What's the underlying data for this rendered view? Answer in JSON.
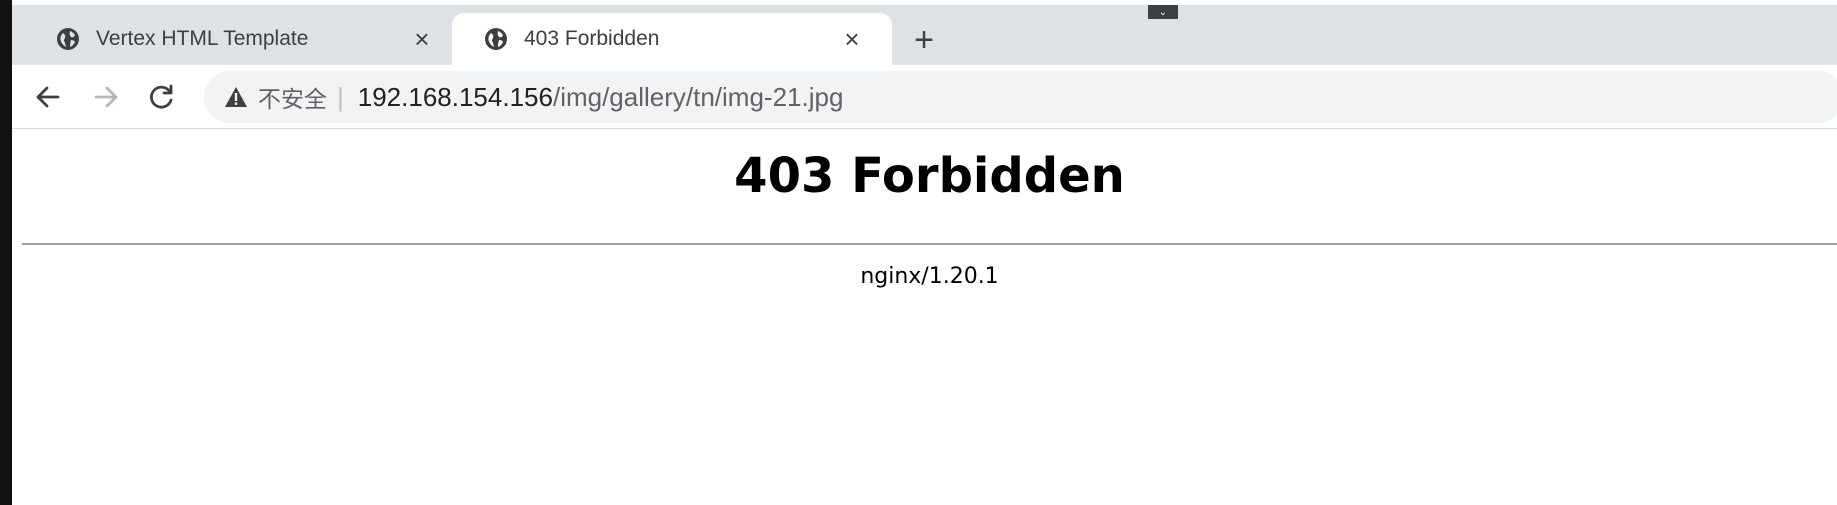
{
  "browser": {
    "tabs": [
      {
        "title": "Vertex HTML Template",
        "active": false,
        "favicon": "globe-icon"
      },
      {
        "title": "403 Forbidden",
        "active": true,
        "favicon": "globe-icon"
      }
    ],
    "new_tab_symbol": "+",
    "close_symbol": "×",
    "tab_search_symbol": "⌄",
    "nav": {
      "back": "arrow-left-icon",
      "forward": "arrow-right-icon",
      "reload": "reload-icon"
    },
    "omnibox": {
      "security_label": "不安全",
      "separator": "|",
      "host": "192.168.154.156",
      "path": "/img/gallery/tn/img-21.jpg",
      "security_icon": "warning-triangle-icon"
    }
  },
  "page": {
    "heading": "403 Forbidden",
    "server": "nginx/1.20.1"
  },
  "colors": {
    "tabstrip": "#dee1e6",
    "omnibox": "#f1f3f4",
    "text": "#3c4043"
  }
}
